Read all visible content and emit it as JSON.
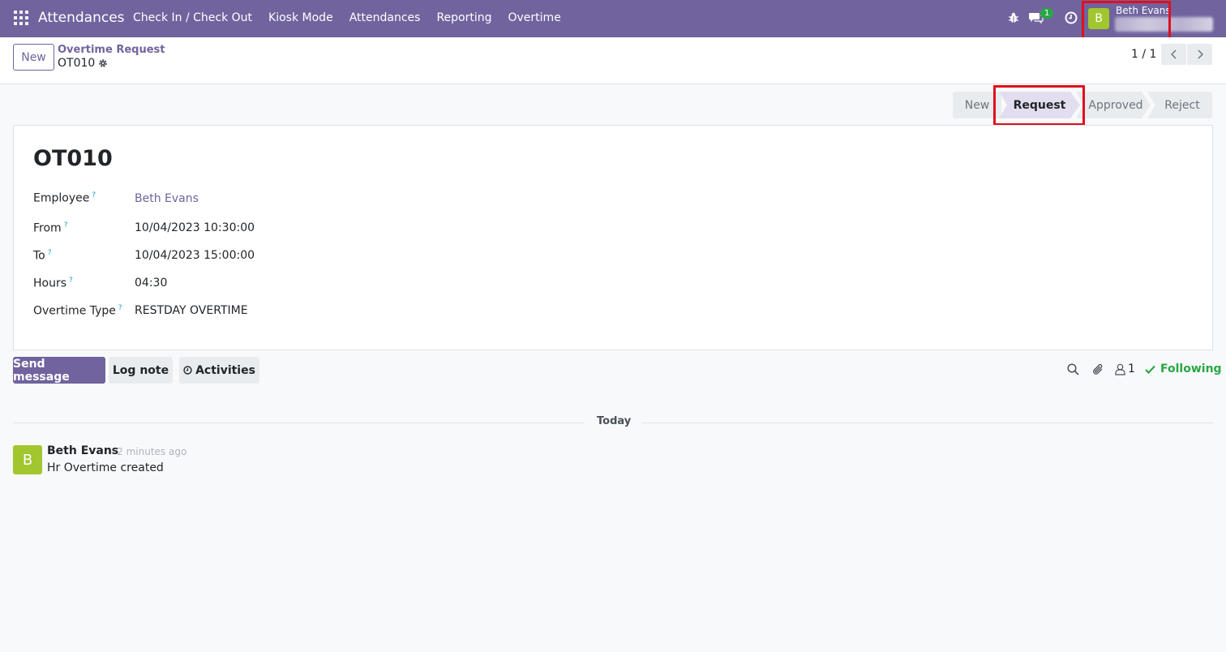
{
  "navbar": {
    "brand": "Attendances",
    "menu": [
      "Check In / Check Out",
      "Kiosk Mode",
      "Attendances",
      "Reporting",
      "Overtime"
    ],
    "chat_badge": "1",
    "user_initial": "B",
    "user_name": "Beth Evans"
  },
  "control_panel": {
    "new_label": "New",
    "breadcrumb_parent": "Overtime Request",
    "breadcrumb_current": "OT010",
    "pager": "1 / 1"
  },
  "statusbar": {
    "stages": [
      "New",
      "Request",
      "Approved",
      "Reject"
    ],
    "active": "Request"
  },
  "form": {
    "title": "OT010",
    "fields": [
      {
        "label": "Employee",
        "help": "?",
        "value": "Beth Evans"
      },
      {
        "label": "From",
        "help": "?",
        "value": "10/04/2023 10:30:00"
      },
      {
        "label": "To",
        "help": "?",
        "value": "10/04/2023 15:00:00"
      },
      {
        "label": "Hours",
        "help": "?",
        "value": "04:30"
      },
      {
        "label": "Overtime Type",
        "help": "?",
        "value": "RESTDAY OVERTIME"
      }
    ]
  },
  "chatter": {
    "send_message": "Send message",
    "log_note": "Log note",
    "activities": "Activities",
    "followers_count": "1",
    "following": "Following",
    "date_separator": "Today",
    "messages": [
      {
        "initial": "B",
        "author": "Beth Evans",
        "time": "- 2 minutes ago",
        "body": "Hr Overtime created"
      }
    ]
  },
  "colors": {
    "brand": "#71639e",
    "avatar": "#a2c62e",
    "following": "#28a745",
    "highlight": "#e0101d"
  }
}
